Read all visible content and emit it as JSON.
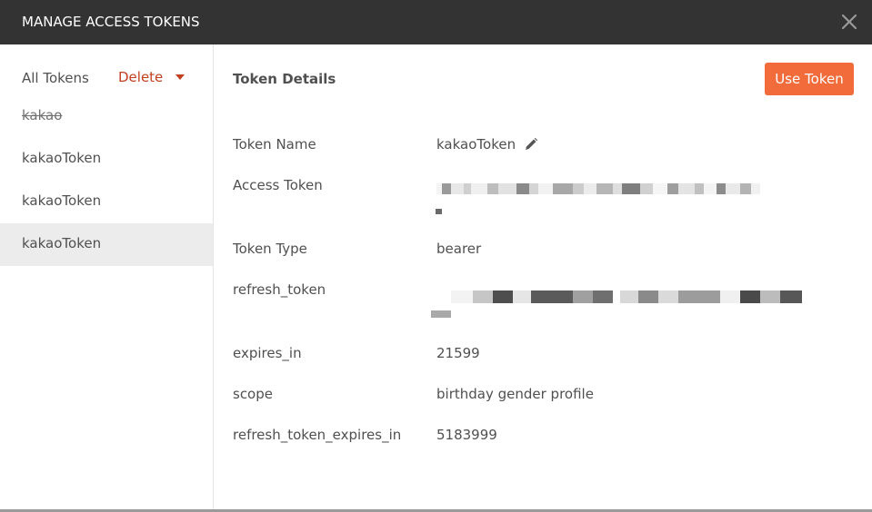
{
  "header": {
    "title": "MANAGE ACCESS TOKENS",
    "close_icon": "close-icon"
  },
  "sidebar": {
    "heading": "All Tokens",
    "delete_label": "Delete",
    "items": [
      {
        "label": "kakao",
        "state": "expired"
      },
      {
        "label": "kakaoToken",
        "state": "normal"
      },
      {
        "label": "kakaoToken",
        "state": "normal"
      },
      {
        "label": "kakaoToken",
        "state": "selected"
      }
    ]
  },
  "details": {
    "title": "Token Details",
    "use_token_label": "Use Token",
    "fields": {
      "token_name": {
        "label": "Token Name",
        "value": "kakaoToken"
      },
      "access_token": {
        "label": "Access Token",
        "value": ""
      },
      "token_type": {
        "label": "Token Type",
        "value": "bearer"
      },
      "refresh_token": {
        "label": "refresh_token",
        "value": ""
      },
      "expires_in": {
        "label": "expires_in",
        "value": "21599"
      },
      "scope": {
        "label": "scope",
        "value": "birthday gender profile"
      },
      "refresh_token_expires_in": {
        "label": "refresh_token_expires_in",
        "value": "5183999"
      }
    }
  },
  "colors": {
    "header_bg": "#333333",
    "accent": "#f26b3a",
    "delete": "#c2401f",
    "selected_bg": "#ececec"
  }
}
